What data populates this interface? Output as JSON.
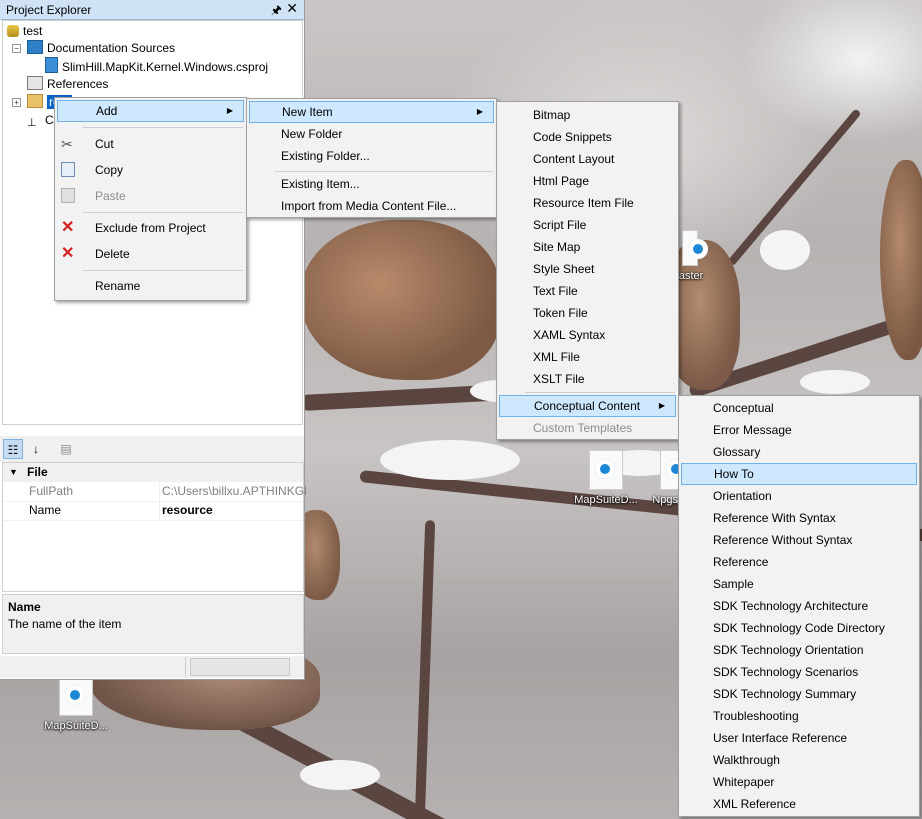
{
  "explorer": {
    "title": "Project Explorer",
    "pin_glyph": "📌",
    "close_glyph": "✕",
    "tree": {
      "root": "test",
      "doc_sources": "Documentation Sources",
      "csproj": "SlimHill.MapKit.Kernel.Windows.csproj",
      "references": "References",
      "selected_folder": "re",
      "collapsed_item": "C"
    },
    "properties": {
      "category": "File",
      "rows": [
        {
          "name": "FullPath",
          "value": "C:\\Users\\billxu.APTHINKGEO"
        },
        {
          "name": "Name",
          "value": "resource"
        }
      ],
      "desc_title": "Name",
      "desc_text": "The name of the item"
    }
  },
  "context_menu": {
    "add": "Add",
    "cut": "Cut",
    "copy": "Copy",
    "paste": "Paste",
    "exclude": "Exclude from Project",
    "delete": "Delete",
    "rename": "Rename"
  },
  "add_menu": {
    "new_item": "New Item",
    "new_folder": "New Folder",
    "existing_folder": "Existing Folder...",
    "existing_item": "Existing Item...",
    "import_media": "Import from Media Content File..."
  },
  "new_item_menu": {
    "items": [
      "Bitmap",
      "Code Snippets",
      "Content Layout",
      "Html Page",
      "Resource Item File",
      "Script File",
      "Site Map",
      "Style Sheet",
      "Text File",
      "Token File",
      "XAML Syntax",
      "XML File",
      "XSLT File"
    ],
    "conceptual": "Conceptual Content",
    "custom": "Custom Templates"
  },
  "conceptual_menu": {
    "items": [
      "Conceptual",
      "Error Message",
      "Glossary",
      "How To",
      "Orientation",
      "Reference With Syntax",
      "Reference Without Syntax",
      "Reference",
      "Sample",
      "SDK Technology Architecture",
      "SDK Technology Code Directory",
      "SDK Technology Orientation",
      "SDK Technology Scenarios",
      "SDK Technology Summary",
      "Troubleshooting",
      "User Interface Reference",
      "Walkthrough",
      "Whitepaper",
      "XML Reference"
    ],
    "highlighted": "How To"
  },
  "desktop": {
    "icon1": "MapSuiteD...",
    "icon2": "Npgs",
    "icon3": "MapSuiteD...",
    "icon4": "-master"
  },
  "colors": {
    "highlight": "#cde8ff",
    "highlight_border": "#6fb1ea",
    "menu_bg": "#f2f2f2",
    "title_bg": "#cfe2f6",
    "delete_red": "#d42020"
  }
}
